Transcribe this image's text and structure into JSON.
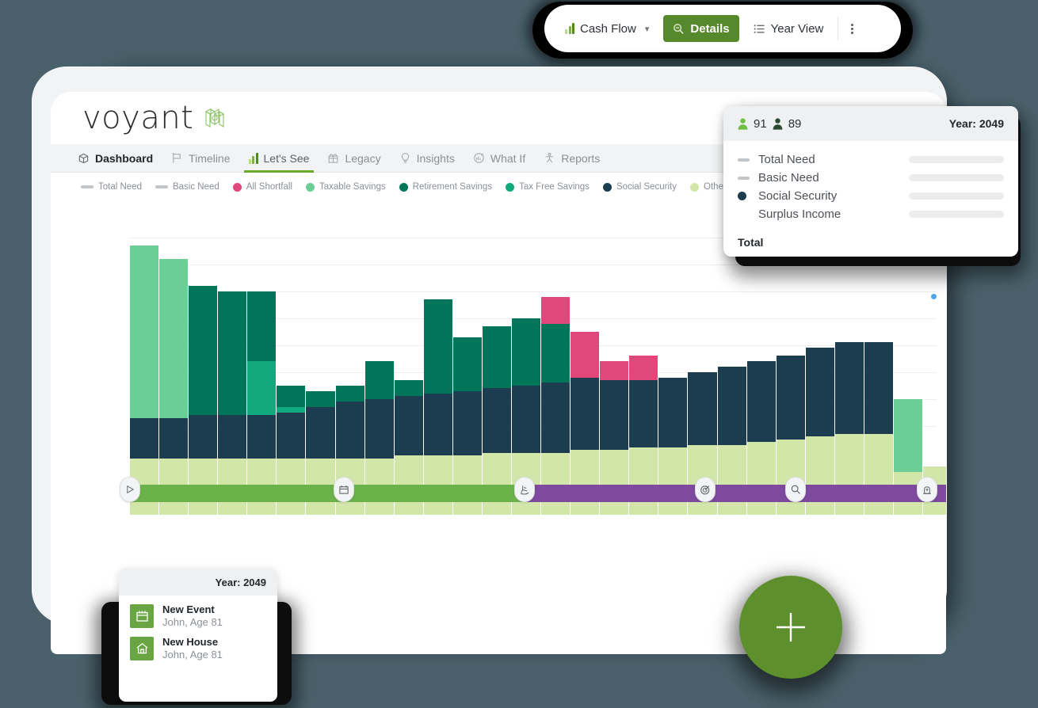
{
  "toolbar": {
    "chart_type_label": "Cash Flow",
    "chart_type_icon": "bar-chart-icon",
    "chevron_icon": "chevron-down-icon",
    "details_label": "Details",
    "details_icon": "search-minus-icon",
    "year_view_label": "Year View",
    "year_view_icon": "list-icon",
    "overflow_icon": "kebab-menu-icon",
    "accent_color": "#56892b"
  },
  "app": {
    "brand": "voyant",
    "brand_icon": "voyant-logo-icon",
    "nav": [
      {
        "label": "Dashboard",
        "icon": "dashboard-icon",
        "state": "active-dark"
      },
      {
        "label": "Timeline",
        "icon": "flag-icon",
        "state": ""
      },
      {
        "label": "Let's See",
        "icon": "bar-chart-icon",
        "state": "active-green"
      },
      {
        "label": "Legacy",
        "icon": "gift-icon",
        "state": ""
      },
      {
        "label": "Insights",
        "icon": "lightbulb-icon",
        "state": ""
      },
      {
        "label": "What If",
        "icon": "what-if-icon",
        "state": ""
      },
      {
        "label": "Reports",
        "icon": "reports-icon",
        "state": ""
      }
    ]
  },
  "legend": [
    {
      "label": "Total Need",
      "marker": "dash",
      "color": "#c3c6c9"
    },
    {
      "label": "Basic Need",
      "marker": "dash",
      "color": "#c3c6c9"
    },
    {
      "label": "All Shortfall",
      "marker": "dot",
      "color": "#e0487b"
    },
    {
      "label": "Taxable Savings",
      "marker": "dot",
      "color": "#6bce94"
    },
    {
      "label": "Retirement Savings",
      "marker": "dot",
      "color": "#00755a"
    },
    {
      "label": "Tax Free Savings",
      "marker": "dot",
      "color": "#13a97f"
    },
    {
      "label": "Social Security",
      "marker": "dot",
      "color": "#1b3d4f"
    },
    {
      "label": "Other Income",
      "marker": "dot",
      "color": "#d3e6a9"
    }
  ],
  "chart_data": {
    "type": "bar",
    "title": "Cash Flow",
    "stacked": true,
    "grid": true,
    "xlabel": "",
    "ylabel": "",
    "ylim": [
      0,
      100
    ],
    "gridlines": [
      18,
      28,
      38,
      48,
      58,
      68,
      78,
      88
    ],
    "series_order": [
      "Other Income",
      "Social Security",
      "Tax Free Savings",
      "Retirement Savings",
      "Taxable Savings",
      "All Shortfall"
    ],
    "colors": {
      "Other Income": "#d3e6a9",
      "Social Security": "#1b3d4f",
      "Tax Free Savings": "#13a97f",
      "Retirement Savings": "#00755a",
      "Taxable Savings": "#6bce94",
      "All Shortfall": "#e0487b"
    },
    "bars": [
      {
        "Other Income": 21,
        "Social Security": 15,
        "Taxable Savings": 64
      },
      {
        "Other Income": 21,
        "Social Security": 15,
        "Taxable Savings": 59
      },
      {
        "Other Income": 21,
        "Social Security": 16,
        "Retirement Savings": 48
      },
      {
        "Other Income": 21,
        "Social Security": 16,
        "Retirement Savings": 46
      },
      {
        "Other Income": 21,
        "Social Security": 16,
        "Tax Free Savings": 20,
        "Retirement Savings": 26
      },
      {
        "Other Income": 21,
        "Social Security": 17,
        "Tax Free Savings": 2,
        "Retirement Savings": 8
      },
      {
        "Other Income": 21,
        "Social Security": 19,
        "Retirement Savings": 6
      },
      {
        "Other Income": 21,
        "Social Security": 21,
        "Retirement Savings": 6
      },
      {
        "Other Income": 21,
        "Social Security": 22,
        "Retirement Savings": 14
      },
      {
        "Other Income": 22,
        "Social Security": 22,
        "Retirement Savings": 6
      },
      {
        "Other Income": 22,
        "Social Security": 23,
        "Retirement Savings": 35
      },
      {
        "Other Income": 22,
        "Social Security": 24,
        "Retirement Savings": 20
      },
      {
        "Other Income": 23,
        "Social Security": 24,
        "Retirement Savings": 23
      },
      {
        "Other Income": 23,
        "Social Security": 25,
        "Retirement Savings": 25
      },
      {
        "Other Income": 23,
        "Social Security": 26,
        "Retirement Savings": 22,
        "All Shortfall": 10
      },
      {
        "Other Income": 24,
        "Social Security": 27,
        "All Shortfall": 17
      },
      {
        "Other Income": 24,
        "Social Security": 26,
        "All Shortfall": 7
      },
      {
        "Other Income": 25,
        "Social Security": 25,
        "All Shortfall": 9
      },
      {
        "Other Income": 25,
        "Social Security": 26
      },
      {
        "Other Income": 26,
        "Social Security": 27
      },
      {
        "Other Income": 26,
        "Social Security": 29
      },
      {
        "Other Income": 27,
        "Social Security": 30
      },
      {
        "Other Income": 28,
        "Social Security": 31
      },
      {
        "Other Income": 29,
        "Social Security": 33
      },
      {
        "Other Income": 30,
        "Social Security": 34
      },
      {
        "Other Income": 30,
        "Social Security": 34
      },
      {
        "Other Income": 16,
        "Taxable Savings": 27
      },
      {
        "Other Income": 18
      }
    ]
  },
  "timeline": {
    "pre_color": "#6cb24a",
    "post_color": "#7d4a9e",
    "split_percent": 48,
    "markers": [
      {
        "icon": "play-icon",
        "left_percent": 0
      },
      {
        "icon": "calendar-icon",
        "left_percent": 26
      },
      {
        "icon": "rocking-chair-icon",
        "left_percent": 48
      },
      {
        "icon": "target-icon",
        "left_percent": 70
      },
      {
        "icon": "magnifier-icon",
        "left_percent": 81
      },
      {
        "icon": "tombstone-icon",
        "left_percent": 97
      }
    ],
    "data_point_marker": "selected-point-dot"
  },
  "tooltip": {
    "age_primary": "91",
    "age_secondary": "89",
    "primary_person_icon": "person-icon",
    "secondary_person_icon": "person-icon",
    "year_label": "Year: 2049",
    "rows": [
      {
        "label": "Total Need",
        "marker": "dash"
      },
      {
        "label": "Basic Need",
        "marker": "dash"
      },
      {
        "label": "Social Security",
        "marker": "dot",
        "color": "#1b3d4f"
      },
      {
        "label": "Surplus Income",
        "marker": "none"
      }
    ],
    "total_label": "Total"
  },
  "events_popup": {
    "year_label": "Year: 2049",
    "items": [
      {
        "title": "New Event",
        "subtitle": "John, Age 81",
        "icon": "calendar-icon"
      },
      {
        "title": "New House",
        "subtitle": "John, Age 81",
        "icon": "house-icon"
      }
    ]
  },
  "fab": {
    "icon": "plus-icon",
    "color": "#5d8f2c"
  }
}
